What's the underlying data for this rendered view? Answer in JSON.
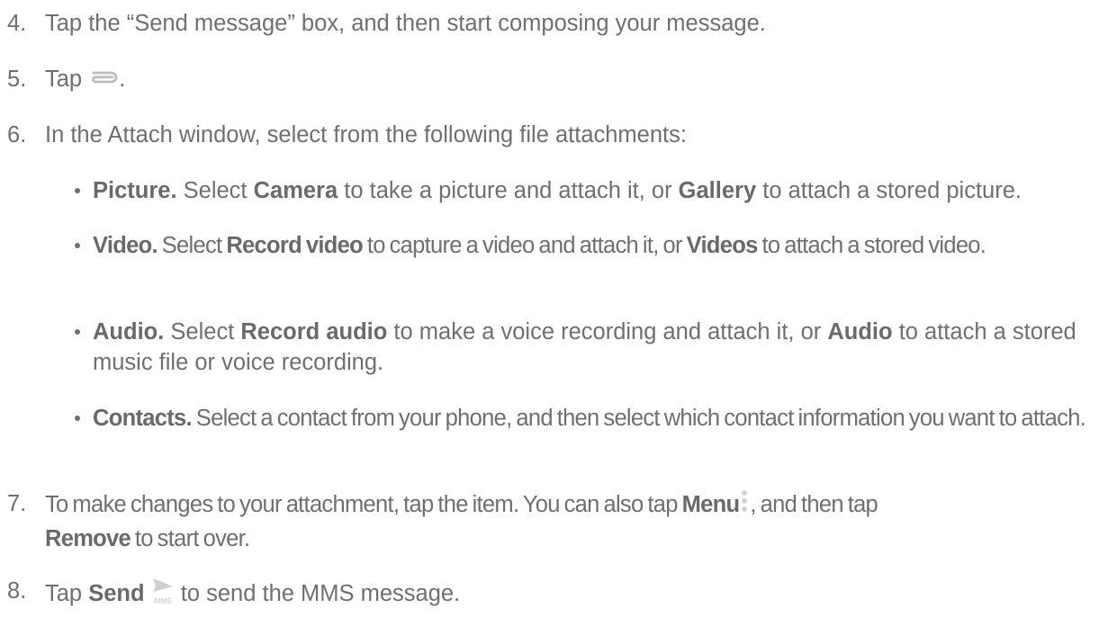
{
  "steps": {
    "s4": {
      "num": "4.",
      "text": "Tap the “Send message” box, and then start composing your message."
    },
    "s5": {
      "num": "5.",
      "pre": "Tap",
      "post": ".",
      "icon": "paperclip-icon"
    },
    "s6": {
      "num": "6.",
      "text": "In the Attach window, select from the following file attachments:"
    },
    "s7": {
      "num": "7.",
      "t1": "To make changes to your attachment, tap the item. You can also tap",
      "b1": "Menu",
      "icon": "overflow-menu-icon",
      "t2": ", and then tap",
      "b2": "Remove",
      "t3": "to start over."
    },
    "s8": {
      "num": "8.",
      "t1": "Tap",
      "b1": "Send",
      "icon": "send-mms-icon",
      "icon_label": "MMS",
      "t2": "to send the MMS message."
    }
  },
  "bullets": {
    "picture": {
      "head": "Picture.",
      "t1": "Select",
      "b1": "Camera",
      "t2": "to take a picture and attach it, or",
      "b2": "Gallery",
      "t3": "to attach a stored picture."
    },
    "video": {
      "head": "Video.",
      "t1": "Select",
      "b1": "Record video",
      "t2": "to capture a video and attach it, or",
      "b2": "Videos",
      "t3": "to attach a stored video."
    },
    "audio": {
      "head": "Audio.",
      "t1": "Select",
      "b1": "Record audio",
      "t2": "to make a voice recording and attach it, or",
      "b2": "Audio",
      "t3": "to attach a stored music file or voice recording."
    },
    "contacts": {
      "head": "Contacts.",
      "t1": "Select a contact from your phone, and then select which contact information you want to attach."
    }
  }
}
